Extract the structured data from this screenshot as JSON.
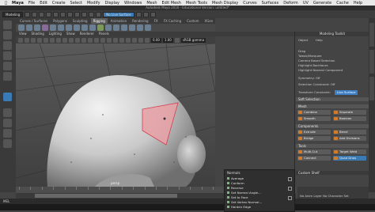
{
  "mac_menu": [
    "Maya",
    "File",
    "Edit",
    "Create",
    "Select",
    "Modify",
    "Display",
    "Windows",
    "Mesh",
    "Edit Mesh",
    "Mesh Tools",
    "Mesh Display",
    "Curves",
    "Surfaces",
    "Deform",
    "UV",
    "Generate",
    "Cache",
    "Help"
  ],
  "window_title": "Autodesk Maya 2016 - Educational Version: untitled*",
  "status": {
    "mode": "Modeling",
    "live_surface": "No Live Surface"
  },
  "shelf_tabs": [
    "Curves / Surfaces",
    "Polygons",
    "Sculpting",
    "Rigging",
    "Animation",
    "Rendering",
    "FX",
    "FX Caching",
    "Custom",
    "XGen"
  ],
  "active_shelf": "Rigging",
  "viewport_menu": [
    "View",
    "Shading",
    "Lighting",
    "Show",
    "Renderer",
    "Panels"
  ],
  "viewport_toolbar": {
    "near": "0.00",
    "far": "1.00",
    "color_space": "sRGB gamma"
  },
  "viewport_label": "persp",
  "modeling_toolkit": {
    "title": "Modeling Toolkit",
    "menus": [
      "Object",
      "Help"
    ],
    "drag": "Drag",
    "tweak": "Tweak/Marquee",
    "options": [
      "Camera Based Selection",
      "Highlight Backfaces",
      "Highlight Nearest Component"
    ],
    "symmetry": "Symmetry: Off",
    "selection_constraint": "Selection Constraint: Off",
    "transform_constraint": "Transform Constraint:",
    "soft_select_value": "Live Surface",
    "soft_selection": "Soft Selection",
    "sections": [
      "Mesh",
      "Components",
      "Tools"
    ],
    "mesh_buttons": [
      "Combine",
      "Separate",
      "Smooth",
      "Boolean"
    ],
    "component_buttons": [
      "Extrude",
      "Bevel",
      "Bridge",
      "Add Divisions"
    ],
    "tool_buttons": [
      "Multi-Cut",
      "Target Weld",
      "Connect",
      "Quad Draw"
    ],
    "custom_shelf": "Custom Shelf"
  },
  "marking_menu": {
    "title": "Normals",
    "items": [
      "Average",
      "Conform",
      "Reverse",
      "Set Normal Angle...",
      "Set to Face",
      "Set Vertex Normal...",
      "Harden Edge"
    ]
  },
  "timeline": {
    "start": "1",
    "end": "120",
    "ticks": [
      "5",
      "10",
      "15",
      "20",
      "25",
      "30",
      "35",
      "40",
      "45",
      "50",
      "55",
      "60",
      "65",
      "70",
      "75",
      "80",
      "85",
      "90",
      "95",
      "100",
      "105",
      "110",
      "115",
      "120"
    ]
  },
  "range_right": "No Anim Layer   No Character Set",
  "mel_label": "MEL",
  "colors": {
    "accent_blue": "#3b7bb5",
    "selection_face": "#e8a0a6",
    "head_mesh": "#dcdcdc"
  }
}
